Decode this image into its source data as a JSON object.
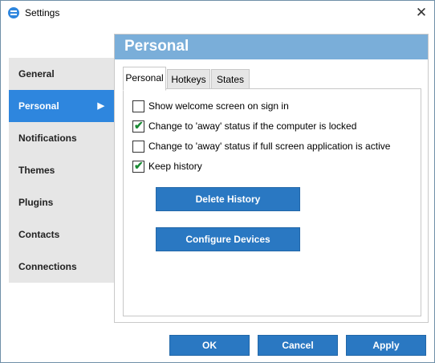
{
  "window": {
    "title": "Settings",
    "icon": "app-icon",
    "close_icon": "close-icon"
  },
  "sidebar": {
    "items": [
      {
        "label": "General"
      },
      {
        "label": "Personal",
        "active": true
      },
      {
        "label": "Notifications"
      },
      {
        "label": "Themes"
      },
      {
        "label": "Plugins"
      },
      {
        "label": "Contacts"
      },
      {
        "label": "Connections"
      }
    ]
  },
  "panel": {
    "title": "Personal",
    "tabs": [
      {
        "label": "Personal",
        "active": true
      },
      {
        "label": "Hotkeys"
      },
      {
        "label": "States"
      }
    ],
    "options": [
      {
        "label": "Show welcome screen on sign in",
        "checked": false
      },
      {
        "label": "Change to 'away' status if the computer is locked",
        "checked": true
      },
      {
        "label": "Change to 'away' status if full screen application is active",
        "checked": false
      },
      {
        "label": "Keep history",
        "checked": true
      }
    ],
    "buttons": {
      "delete_history": "Delete History",
      "configure_devices": "Configure Devices"
    }
  },
  "footer": {
    "ok": "OK",
    "cancel": "Cancel",
    "apply": "Apply"
  },
  "colors": {
    "accent": "#2e86de",
    "header": "#7aaed9",
    "button": "#2a78c2",
    "check": "#1a8a34"
  }
}
